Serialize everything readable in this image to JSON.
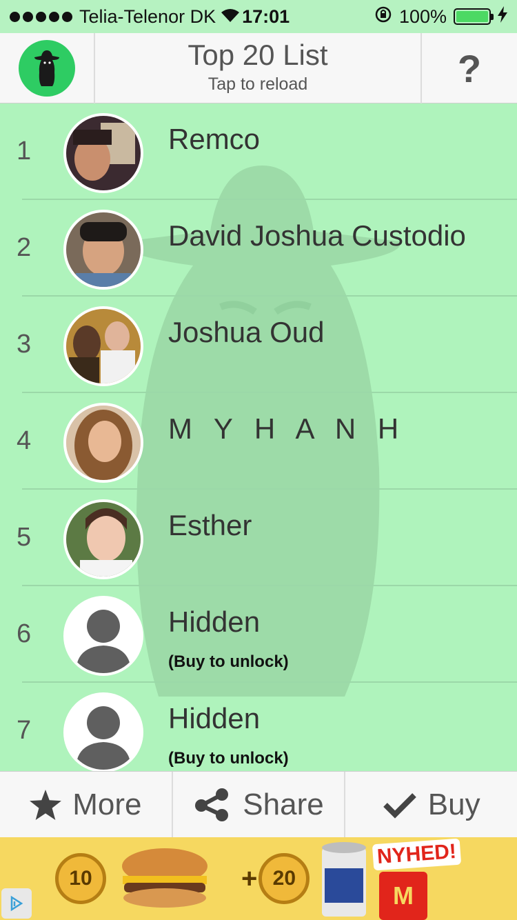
{
  "status_bar": {
    "carrier": "Telia-Telenor DK",
    "time": "17:01",
    "battery": "100%",
    "battery_level": 1.0
  },
  "header": {
    "title": "Top 20 List",
    "subtitle": "Tap to reload",
    "help_label": "?"
  },
  "list": {
    "items": [
      {
        "rank": "1",
        "name": "Remco",
        "note": ""
      },
      {
        "rank": "2",
        "name": "David Joshua Custodio",
        "note": ""
      },
      {
        "rank": "3",
        "name": "Joshua Oud",
        "note": ""
      },
      {
        "rank": "4",
        "name": "M Y H A N H",
        "note": ""
      },
      {
        "rank": "5",
        "name": "Esther",
        "note": ""
      },
      {
        "rank": "6",
        "name": "Hidden",
        "note": "(Buy to unlock)"
      },
      {
        "rank": "7",
        "name": "Hidden",
        "note": "(Buy to unlock)"
      }
    ]
  },
  "toolbar": {
    "more_label": "More",
    "share_label": "Share",
    "buy_label": "Buy"
  },
  "ad": {
    "coin1": "10",
    "plus": "+",
    "coin2": "20",
    "badge": "NYHED!",
    "brand_mark": "M"
  },
  "colors": {
    "list_bg": "#aff3bc",
    "logo_green": "#2ecc63",
    "ad_yellow": "#f6d860"
  }
}
